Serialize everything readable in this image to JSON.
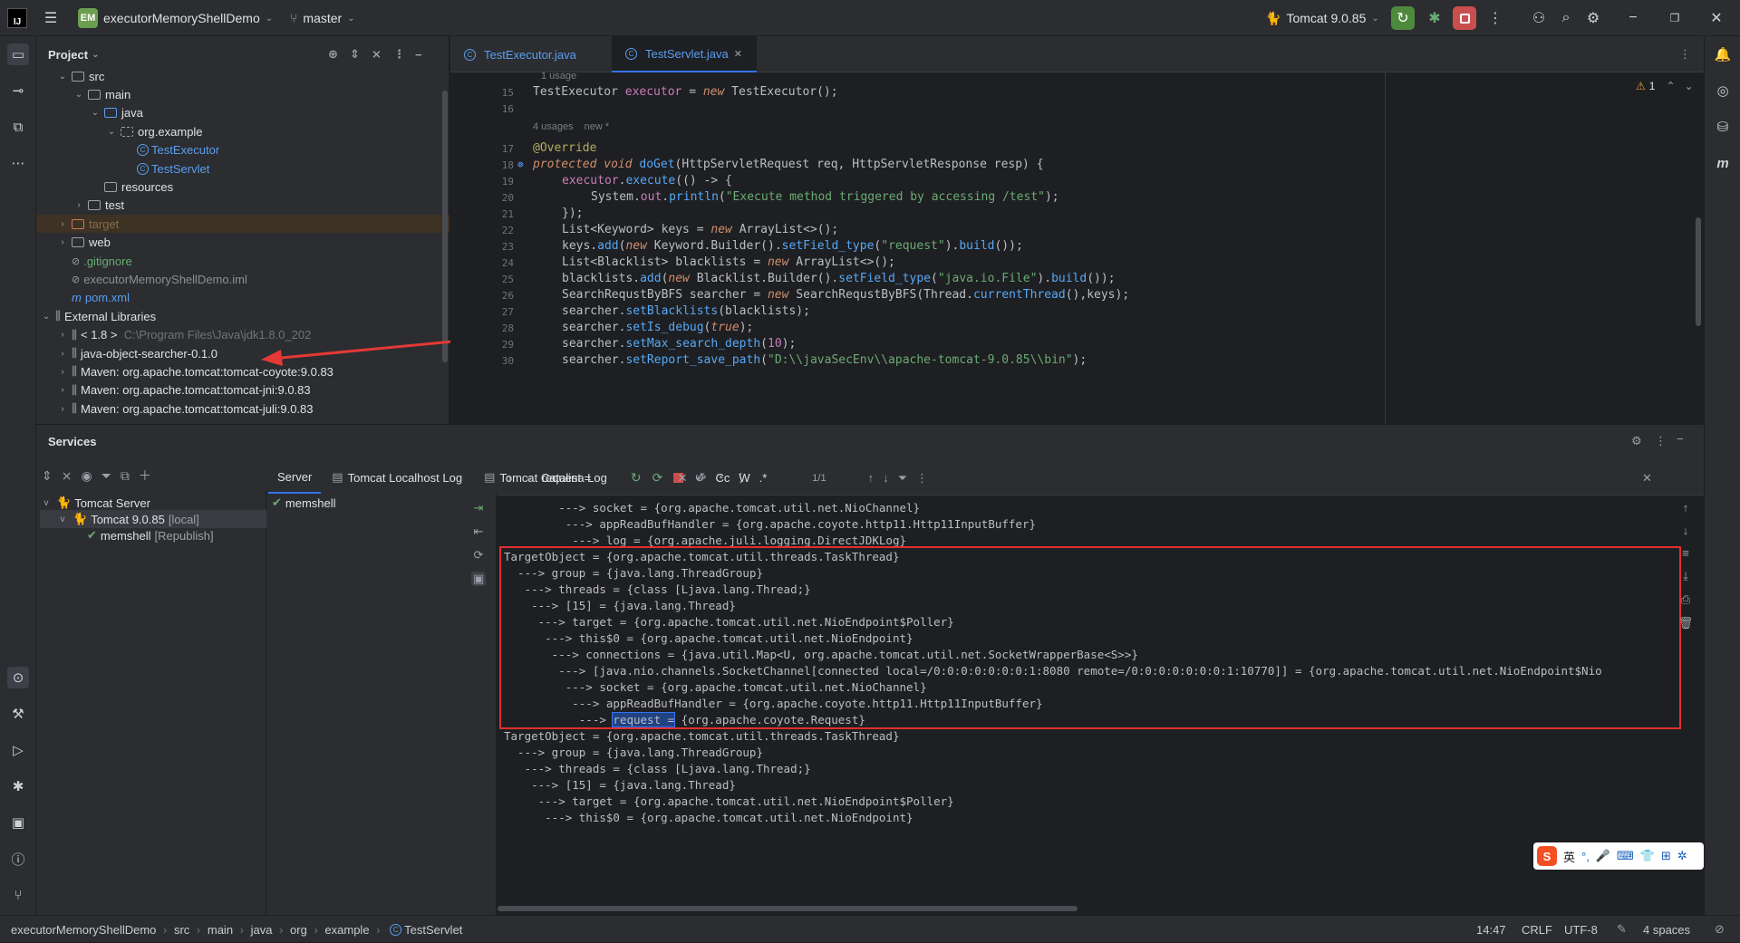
{
  "titlebar": {
    "logo": "IJ",
    "project_badge": "EM",
    "project_name": "executorMemoryShellDemo",
    "branch": "master",
    "run_config": "Tomcat 9.0.85"
  },
  "project_panel": {
    "title": "Project",
    "tree": [
      {
        "label": "src",
        "indent": 1,
        "chev": "v",
        "icon": "folder"
      },
      {
        "label": "main",
        "indent": 2,
        "chev": "v",
        "icon": "folder"
      },
      {
        "label": "java",
        "indent": 3,
        "chev": "v",
        "icon": "folder-blue"
      },
      {
        "label": "org.example",
        "indent": 4,
        "chev": "v",
        "icon": "package"
      },
      {
        "label": "TestExecutor",
        "indent": 5,
        "chev": "",
        "icon": "class"
      },
      {
        "label": "TestServlet",
        "indent": 5,
        "chev": "",
        "icon": "class"
      },
      {
        "label": "resources",
        "indent": 3,
        "chev": "",
        "icon": "folder"
      },
      {
        "label": "test",
        "indent": 2,
        "chev": ">",
        "icon": "folder"
      },
      {
        "label": "target",
        "indent": 1,
        "chev": ">",
        "icon": "folder-orange"
      },
      {
        "label": "web",
        "indent": 1,
        "chev": ">",
        "icon": "folder"
      },
      {
        "label": ".gitignore",
        "indent": 1,
        "chev": "",
        "icon": "file"
      },
      {
        "label": "executorMemoryShellDemo.iml",
        "indent": 1,
        "chev": "",
        "icon": "file"
      },
      {
        "label": "pom.xml",
        "indent": 1,
        "chev": "",
        "icon": "maven"
      },
      {
        "label": "External Libraries",
        "indent": 0,
        "chev": "v",
        "icon": "lib"
      },
      {
        "label": "< 1.8 >",
        "suffix": "C:\\Program Files\\Java\\jdk1.8.0_202",
        "indent": 1,
        "chev": ">",
        "icon": "lib"
      },
      {
        "label": "java-object-searcher-0.1.0",
        "indent": 1,
        "chev": ">",
        "icon": "lib"
      },
      {
        "label": "Maven: org.apache.tomcat:tomcat-coyote:9.0.83",
        "indent": 1,
        "chev": ">",
        "icon": "lib"
      },
      {
        "label": "Maven: org.apache.tomcat:tomcat-jni:9.0.83",
        "indent": 1,
        "chev": ">",
        "icon": "lib"
      },
      {
        "label": "Maven: org.apache.tomcat:tomcat-juli:9.0.83",
        "indent": 1,
        "chev": ">",
        "icon": "lib"
      }
    ]
  },
  "editor": {
    "tabs": [
      "TestExecutor.java",
      "TestServlet.java"
    ],
    "warnings": "1",
    "usages_top": "1 usage",
    "hint_usages": "4 usages",
    "hint_new": "new *",
    "lines": [
      {
        "n": "15",
        "html": "TestExecutor"
      },
      {
        "n": "16"
      },
      {
        "n": "17"
      },
      {
        "n": "18"
      },
      {
        "n": "19"
      },
      {
        "n": "20"
      },
      {
        "n": "21"
      },
      {
        "n": "22"
      },
      {
        "n": "23"
      },
      {
        "n": "24"
      },
      {
        "n": "25"
      },
      {
        "n": "26"
      },
      {
        "n": "27"
      },
      {
        "n": "28"
      },
      {
        "n": "29"
      },
      {
        "n": "30"
      }
    ]
  },
  "services": {
    "title": "Services",
    "tree": [
      {
        "label": "Tomcat Server"
      },
      {
        "label": "Tomcat 9.0.85",
        "suffix": "[local]"
      },
      {
        "label": "memshell",
        "suffix": "[Republish]"
      }
    ],
    "tabs": [
      "Server",
      "Tomcat Localhost Log",
      "Tomcat Catalina Log"
    ],
    "deployments": [
      "memshell"
    ],
    "search": {
      "value": "request =",
      "count": "1/1",
      "cc": "Cc",
      "w": "W",
      "regex": ".*"
    }
  },
  "console_lines": [
    "        ---> socket = {org.apache.tomcat.util.net.NioChannel}",
    "         ---> appReadBufHandler = {org.apache.coyote.http11.Http11InputBuffer}",
    "          ---> log = {org.apache.juli.logging.DirectJDKLog}",
    "TargetObject = {org.apache.tomcat.util.threads.TaskThread}",
    "  ---> group = {java.lang.ThreadGroup}",
    "   ---> threads = {class [Ljava.lang.Thread;}",
    "    ---> [15] = {java.lang.Thread}",
    "     ---> target = {org.apache.tomcat.util.net.NioEndpoint$Poller}",
    "      ---> this$0 = {org.apache.tomcat.util.net.NioEndpoint}",
    "       ---> connections = {java.util.Map<U, org.apache.tomcat.util.net.SocketWrapperBase<S>>}",
    "        ---> [java.nio.channels.SocketChannel[connected local=/0:0:0:0:0:0:0:1:8080 remote=/0:0:0:0:0:0:0:1:10770]] = {org.apache.tomcat.util.net.NioEndpoint$Nio",
    "         ---> socket = {org.apache.tomcat.util.net.NioChannel}",
    "          ---> appReadBufHandler = {org.apache.coyote.http11.Http11InputBuffer}",
    "TargetObject = {org.apache.tomcat.util.threads.TaskThread}",
    "  ---> group = {java.lang.ThreadGroup}",
    "   ---> threads = {class [Ljava.lang.Thread;}",
    "    ---> [15] = {java.lang.Thread}",
    "     ---> target = {org.apache.tomcat.util.net.NioEndpoint$Poller}",
    "      ---> this$0 = {org.apache.tomcat.util.net.NioEndpoint}"
  ],
  "console_match": {
    "prefix": "           ---> ",
    "match": "request =",
    "rest": " {org.apache.coyote.Request}"
  },
  "ime": {
    "logo": "S",
    "lang": "英"
  },
  "status": {
    "breadcrumbs": [
      "executorMemoryShellDemo",
      "src",
      "main",
      "java",
      "org",
      "example",
      "TestServlet"
    ],
    "position": "14:47",
    "line_sep": "CRLF",
    "encoding": "UTF-8",
    "indent": "4 spaces"
  },
  "colors": {
    "highlight_box": "#e02e2e",
    "arrow": "#e53935",
    "link": "#5a9ef0"
  }
}
